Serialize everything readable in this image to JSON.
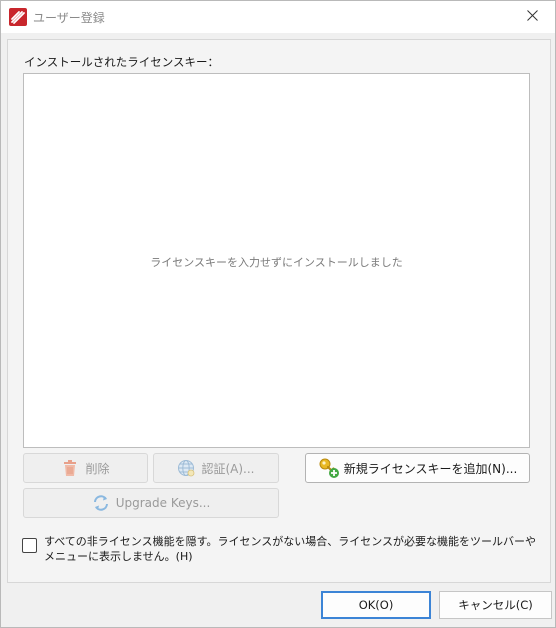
{
  "window": {
    "title": "ユーザー登録",
    "close_glyph": "✕"
  },
  "licenses": {
    "section_label": "インストールされたライセンスキー：",
    "empty_message": "ライセンスキーを入力せずにインストールしました",
    "keys": []
  },
  "buttons": {
    "delete_label": "削除",
    "authenticate_label": "認証(A)...",
    "add_key_label": "新規ライセンスキーを追加(N)...",
    "upgrade_keys_label": "Upgrade Keys..."
  },
  "options": {
    "hide_unlicensed_label": "すべての非ライセンス機能を隠す。ライセンスがない場合、ライセンスが必要な機能をツールバーやメニューに表示しません。(H)",
    "hide_unlicensed_checked": false
  },
  "footer": {
    "ok_label": "OK(O)",
    "cancel_label": "キャンセル(C)"
  },
  "colors": {
    "accent": "#3c84d6",
    "brand_red": "#c8262c"
  }
}
